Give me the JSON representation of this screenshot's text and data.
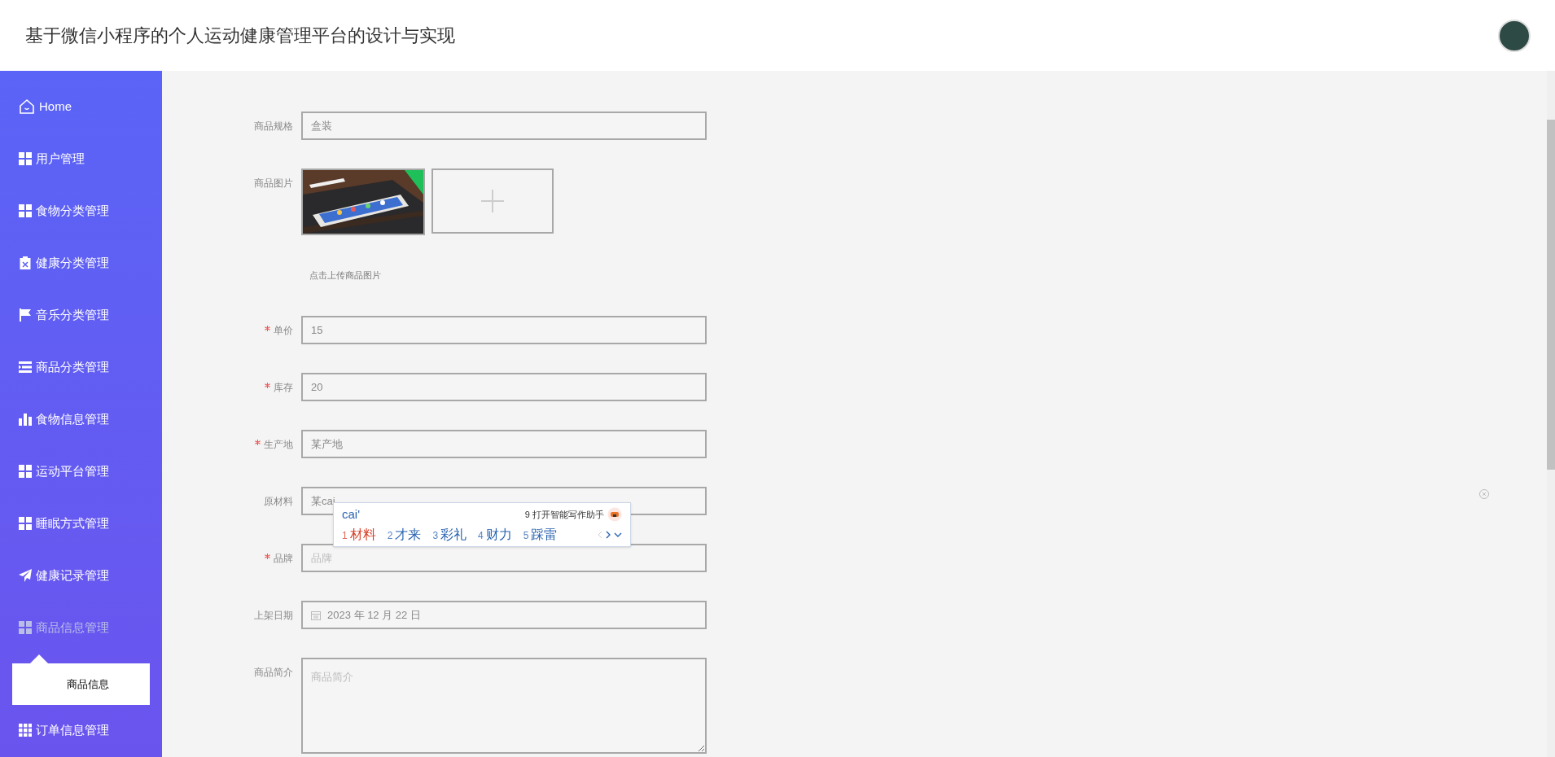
{
  "header": {
    "title": "基于微信小程序的个人运动健康管理平台的设计与实现"
  },
  "sidebar": {
    "items": [
      {
        "label": "Home",
        "kind": "home",
        "expanded": false
      },
      {
        "label": "用户管理",
        "kind": "grid",
        "expanded": false
      },
      {
        "label": "食物分类管理",
        "kind": "grid",
        "expanded": false
      },
      {
        "label": "健康分类管理",
        "kind": "clipboard",
        "expanded": false
      },
      {
        "label": "音乐分类管理",
        "kind": "flag",
        "expanded": false
      },
      {
        "label": "商品分类管理",
        "kind": "list",
        "expanded": false
      },
      {
        "label": "食物信息管理",
        "kind": "bars",
        "expanded": false
      },
      {
        "label": "运动平台管理",
        "kind": "grid",
        "expanded": false
      },
      {
        "label": "睡眠方式管理",
        "kind": "grid",
        "expanded": false
      },
      {
        "label": "健康记录管理",
        "kind": "plane",
        "expanded": false
      },
      {
        "label": "商品信息管理",
        "kind": "grid",
        "expanded": true,
        "children": [
          {
            "label": "商品信息"
          }
        ]
      },
      {
        "label": "订单信息管理",
        "kind": "grid9",
        "expanded": false
      }
    ]
  },
  "form": {
    "fields": [
      {
        "kind": "text",
        "label": "商品规格",
        "required": false,
        "value": "盒装"
      },
      {
        "label": "商品图片",
        "required": false,
        "hint": "点击上传商品图片"
      },
      {
        "kind": "text",
        "label": "单价",
        "required": true,
        "value": "15"
      },
      {
        "kind": "text",
        "label": "库存",
        "required": true,
        "value": "20"
      },
      {
        "kind": "text",
        "label": "生产地",
        "required": true,
        "value": "某产地"
      },
      {
        "kind": "text",
        "label": "原材料",
        "required": false,
        "value": "某cai",
        "clearable": true
      },
      {
        "kind": "text",
        "label": "品牌",
        "required": true,
        "placeholder": "品牌"
      },
      {
        "kind": "date",
        "label": "上架日期",
        "required": false,
        "value": "2023 年 12 月 22 日"
      },
      {
        "kind": "textarea",
        "label": "商品简介",
        "required": false,
        "placeholder": "商品简介"
      }
    ]
  },
  "ime": {
    "composition": "cai'",
    "assistant": "9 打开智能写作助手",
    "candidates": [
      {
        "index": "1",
        "text": "材料",
        "selected": true
      },
      {
        "index": "2",
        "text": "才来",
        "selected": false
      },
      {
        "index": "3",
        "text": "彩礼",
        "selected": false
      },
      {
        "index": "4",
        "text": "财力",
        "selected": false
      },
      {
        "index": "5",
        "text": "踩雷",
        "selected": false
      }
    ]
  }
}
